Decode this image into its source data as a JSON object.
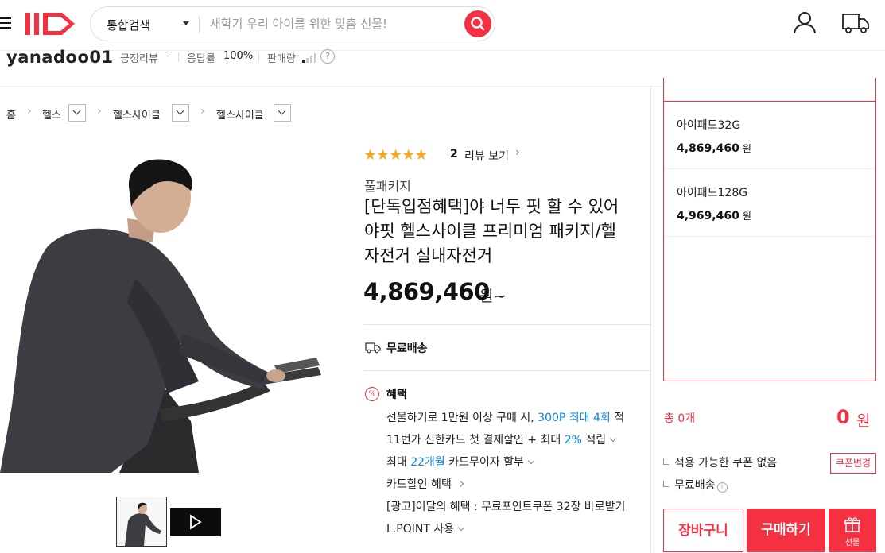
{
  "header": {
    "search_category": "통합검색",
    "search_placeholder": "새학기 우리 아이를 위한 맞춤 선물!"
  },
  "seller": {
    "name": "yanadoo01",
    "positive_review_label": "긍정리뷰",
    "positive_review_value": "-",
    "response_label": "응답률",
    "response_value": "100%",
    "sales_label": "판매량"
  },
  "breadcrumb": [
    "홈",
    "헬스",
    "헬스사이클",
    "헬스사이클"
  ],
  "product": {
    "rating_stars": "★★★★★",
    "review_count": "2",
    "review_label": "리뷰 보기",
    "package": "풀패키지",
    "title_lines": [
      "[단독입점혜택]야 너두 핏 할 수 있어",
      "야핏 헬스사이클 프리미엄 패키지/헬",
      "자전거 실내자전거"
    ],
    "price": "4,869,460",
    "price_unit": "원~",
    "shipping": "무료배송",
    "benefits_title": "혜택",
    "benefits": {
      "b1_prefix": "선물하기로 1만원 이상 구매 시,",
      "b1_blue": "300P 최대 4회",
      "b1_suffix": "적",
      "b2_prefix": "11번가 신한카드 첫 결제할인 + 최대",
      "b2_blue": "2%",
      "b2_suffix": "적립",
      "b3_prefix": "최대",
      "b3_blue": "22개월",
      "b3_suffix": "카드무이자 할부",
      "b4": "카드할인 혜택",
      "b5": "[광고]이달의 혜택 : 무료포인트쿠폰 32장 바로받기",
      "b6": "L.POINT 사용"
    }
  },
  "options": [
    {
      "name": "아이패드32G",
      "price": "4,869,460",
      "won": "원"
    },
    {
      "name": "아이패드128G",
      "price": "4,969,460",
      "won": "원"
    }
  ],
  "summary": {
    "total_label": "총 0개",
    "total_value": "0",
    "total_unit": "원",
    "coupon_note": "적용 가능한 쿠폰 없음",
    "coupon_button": "쿠폰변경",
    "shipping_note": "무료배송",
    "info_glyph": "i"
  },
  "actions": {
    "cart": "장바구니",
    "buy": "구매하기",
    "gift": "선물"
  },
  "colors": {
    "accent": "#f43142",
    "blue": "#0b83e6",
    "star": "#f5a623"
  }
}
